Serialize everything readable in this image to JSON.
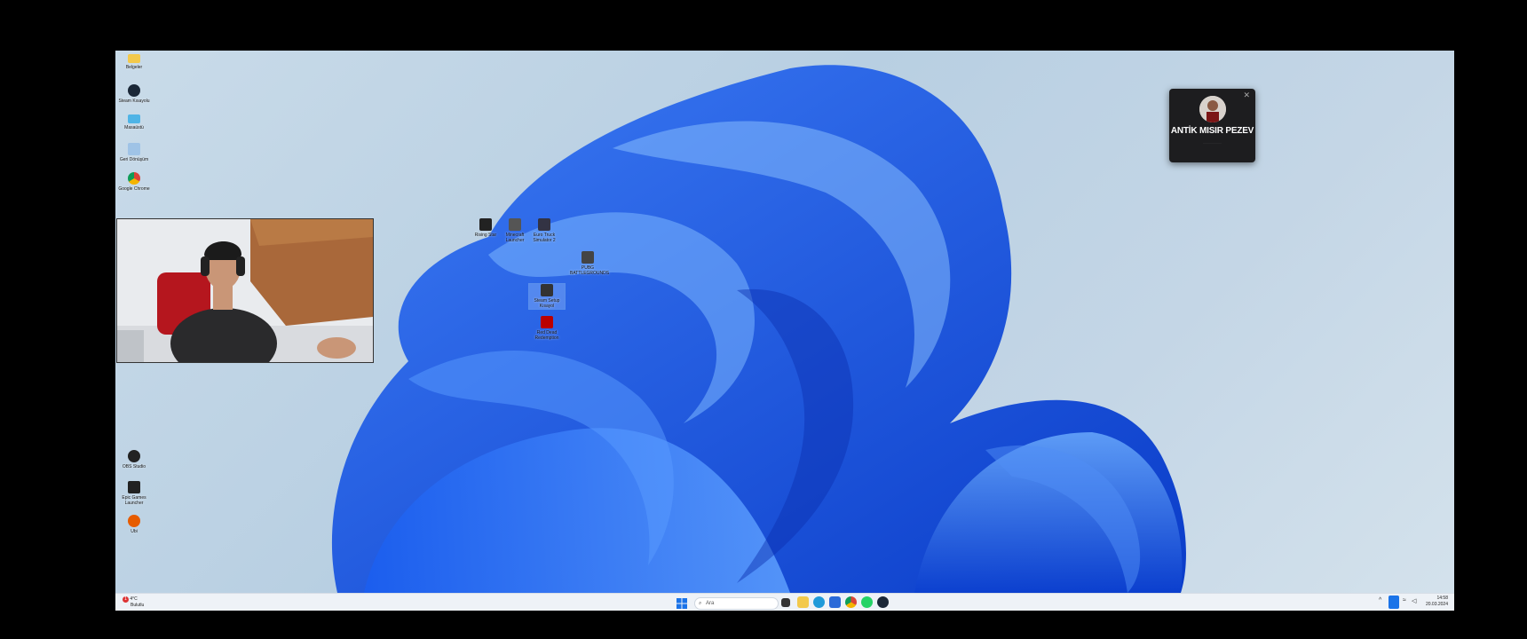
{
  "desktop_icons_left": [
    {
      "label": "Belgeler",
      "icon": "folder-icon",
      "color": "#f3c94b"
    },
    {
      "label": "Steam Kısayolu",
      "icon": "steam-icon",
      "color": "#1b2838"
    },
    {
      "label": "Masaüstü",
      "icon": "monitor-icon",
      "color": "#4fb4e6"
    },
    {
      "label": "Geri Dönüşüm",
      "icon": "recycle-bin-icon",
      "color": "#9fc3e6"
    },
    {
      "label": "Google Chrome",
      "icon": "chrome-icon",
      "color": "#db4437"
    }
  ],
  "desktop_icons_center": [
    {
      "label": "Rising Star",
      "icon": "game-icon",
      "color": "#222"
    },
    {
      "label": "Minecraft Launcher",
      "icon": "game-icon",
      "color": "#555"
    },
    {
      "label": "Euro Truck Simulator 2",
      "icon": "game-icon",
      "color": "#334"
    },
    {
      "label": "PUBG BATTLEGROUNDS",
      "icon": "game-icon",
      "color": "#444"
    },
    {
      "label": "Steam Setup Kısayol",
      "icon": "game-icon",
      "color": "#333"
    },
    {
      "label": "Red Dead Redemption",
      "icon": "game-icon",
      "color": "#b00"
    }
  ],
  "desktop_icons_left_bottom": [
    {
      "label": "OBS Studio",
      "icon": "obs-icon",
      "color": "#222"
    },
    {
      "label": "Epic Games Launcher",
      "icon": "epic-icon",
      "color": "#222"
    },
    {
      "label": "Ubi",
      "icon": "ubisoft-icon",
      "color": "#e65c00"
    }
  ],
  "notification": {
    "name": "ANTİK MISIR PEZEV",
    "close": "✕",
    "subtitle": "·····················"
  },
  "taskbar": {
    "search_placeholder": "Ara",
    "weather_temp": "4°C",
    "weather_desc": "Bulutlu",
    "weather_badge": "1",
    "time": "14:58",
    "date": "20.03.2024",
    "pinned": [
      {
        "icon": "task-view-icon",
        "color": "#333"
      },
      {
        "icon": "file-explorer-icon",
        "color": "#f3c94b"
      },
      {
        "icon": "edge-icon",
        "color": "#1f9ad9"
      },
      {
        "icon": "store-icon",
        "color": "#2a6ad8"
      },
      {
        "icon": "chrome-icon",
        "color": "#db4437"
      },
      {
        "icon": "whatsapp-icon",
        "color": "#25d366"
      },
      {
        "icon": "steam-icon",
        "color": "#1b2838"
      }
    ]
  }
}
